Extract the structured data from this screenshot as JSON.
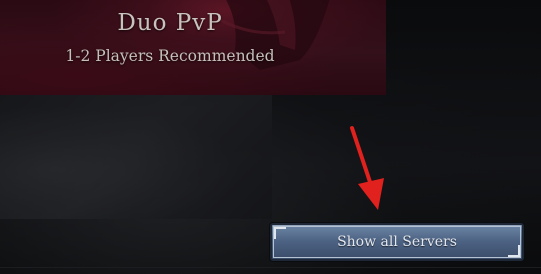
{
  "mode_card": {
    "title": "Duo PvP",
    "subtitle": "1-2 Players Recommended"
  },
  "actions": {
    "show_all_servers_label": "Show all Servers"
  },
  "annotation": {
    "arrow_color": "#e0211d",
    "arrow_icon": "arrow-down-icon"
  },
  "colors": {
    "card_red": "#33101a",
    "button_blue": "#4e6485"
  }
}
